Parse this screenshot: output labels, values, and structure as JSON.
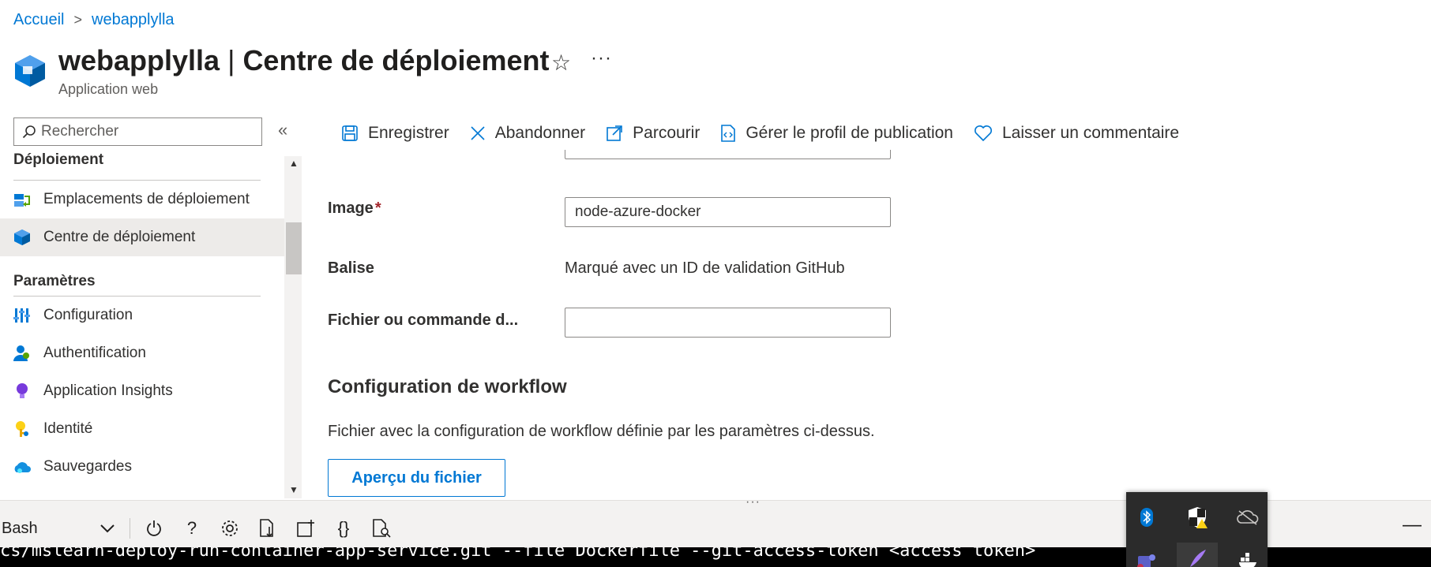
{
  "breadcrumb": {
    "home": "Accueil",
    "current": "webapplylla"
  },
  "header": {
    "resource_name": "webapplylla",
    "separator": " | ",
    "page_name": "Centre de déploiement",
    "subtitle": "Application web",
    "more": "···"
  },
  "search": {
    "placeholder": "Rechercher"
  },
  "toolbar": {
    "save": "Enregistrer",
    "discard": "Abandonner",
    "browse": "Parcourir",
    "manage_profile": "Gérer le profil de publication",
    "feedback": "Laisser un commentaire"
  },
  "sidebar": {
    "section_deploy": "Déploiement",
    "deploy_items": [
      {
        "label": "Emplacements de déploiement",
        "icon": "deployment-slots-icon"
      },
      {
        "label": "Centre de déploiement",
        "icon": "deployment-center-icon",
        "active": true
      }
    ],
    "section_settings": "Paramètres",
    "settings_items": [
      {
        "label": "Configuration",
        "icon": "configuration-icon"
      },
      {
        "label": "Authentification",
        "icon": "authentication-icon"
      },
      {
        "label": "Application Insights",
        "icon": "app-insights-icon"
      },
      {
        "label": "Identité",
        "icon": "identity-icon"
      },
      {
        "label": "Sauvegardes",
        "icon": "backups-icon"
      }
    ]
  },
  "form": {
    "image_label": "Image",
    "image_required": "*",
    "image_value": "node-azure-docker",
    "tag_label": "Balise",
    "tag_value": "Marqué avec un ID de validation GitHub",
    "startup_label": "Fichier ou commande d...",
    "startup_value": ""
  },
  "workflow": {
    "title": "Configuration de workflow",
    "description": "Fichier avec la configuration de workflow définie par les paramètres ci-dessus.",
    "preview_button": "Aperçu du fichier"
  },
  "shell": {
    "type": "Bash",
    "terminal_line": "cs/mslearn-deploy-run-container-app-service.git --file Dockerfile --git-access-token <access token>"
  },
  "colors": {
    "accent": "#0078d4",
    "required": "#a4262c",
    "selected_bg": "#edebe9"
  }
}
